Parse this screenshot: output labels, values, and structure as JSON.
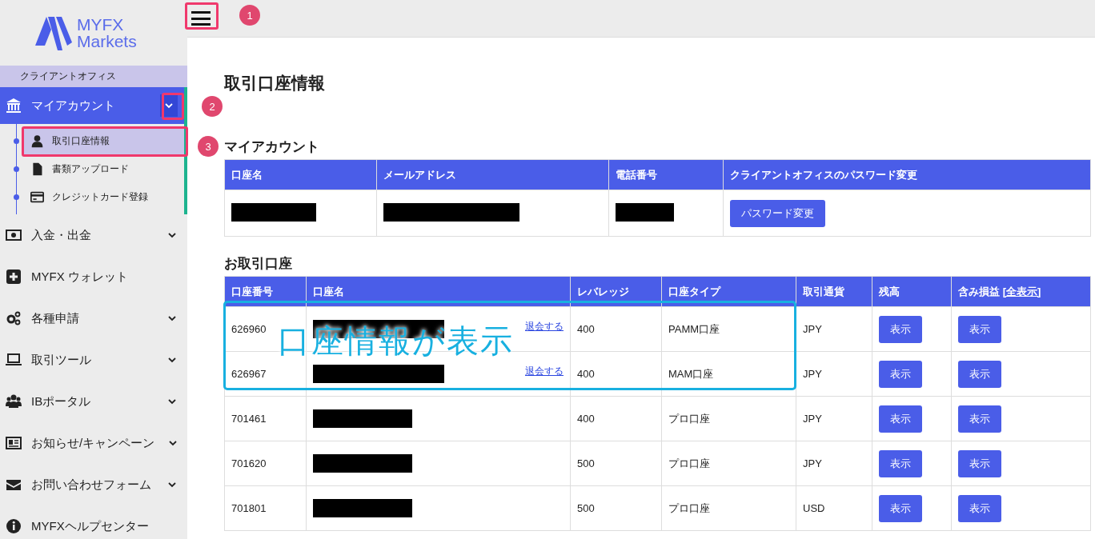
{
  "logo": {
    "line1": "MYFX",
    "line2": "Markets"
  },
  "sidebar": {
    "section": "クライアントオフィス",
    "items": [
      {
        "label": "マイアカウント",
        "kind": "group",
        "selected": true,
        "children": [
          {
            "label": "取引口座情報",
            "selected": true
          },
          {
            "label": "書類アップロード",
            "selected": false
          },
          {
            "label": "クレジットカード登録",
            "selected": false
          }
        ]
      },
      {
        "label": "入金・出金",
        "kind": "group",
        "selected": false
      },
      {
        "label": "MYFX ウォレット",
        "kind": "link",
        "selected": false
      },
      {
        "label": "各種申請",
        "kind": "group",
        "selected": false
      },
      {
        "label": "取引ツール",
        "kind": "group",
        "selected": false
      },
      {
        "label": "IBポータル",
        "kind": "group",
        "selected": false
      },
      {
        "label": "お知らせ/キャンペーン",
        "kind": "group",
        "selected": false
      },
      {
        "label": "お問い合わせフォーム",
        "kind": "group",
        "selected": false
      },
      {
        "label": "MYFXヘルプセンター",
        "kind": "link",
        "selected": false
      }
    ]
  },
  "page_title": "取引口座情報",
  "my_account": {
    "heading": "マイアカウント",
    "columns": [
      "口座名",
      "メールアドレス",
      "電話番号",
      "クライアントオフィスのパスワード変更"
    ],
    "row": {
      "name_redacted": true,
      "email_redacted": true,
      "phone_redacted": true,
      "button": "パスワード変更"
    }
  },
  "trading_accounts": {
    "heading": "お取引口座",
    "columns": [
      "口座番号",
      "口座名",
      "レバレッジ",
      "口座タイプ",
      "取引通貨",
      "残高",
      "含み損益 "
    ],
    "columns_link": "[全表示]",
    "rows": [
      {
        "number": "626960",
        "name_redacted": true,
        "withdraw_link": "退会する",
        "leverage": "400",
        "type": "PAMM口座",
        "currency": "JPY",
        "balance_button": "表示",
        "pl_button": "表示"
      },
      {
        "number": "626967",
        "name_redacted": true,
        "withdraw_link": "退会する",
        "leverage": "400",
        "type": "MAM口座",
        "currency": "JPY",
        "balance_button": "表示",
        "pl_button": "表示"
      },
      {
        "number": "701461",
        "name_redacted": true,
        "leverage": "400",
        "type": "プロ口座",
        "currency": "JPY",
        "balance_button": "表示",
        "pl_button": "表示"
      },
      {
        "number": "701620",
        "name_redacted": true,
        "leverage": "500",
        "type": "プロ口座",
        "currency": "JPY",
        "balance_button": "表示",
        "pl_button": "表示"
      },
      {
        "number": "701801",
        "name_redacted": true,
        "leverage": "500",
        "type": "プロ口座",
        "currency": "USD",
        "balance_button": "表示",
        "pl_button": "表示"
      }
    ]
  },
  "annotations": {
    "callouts": [
      "1",
      "2",
      "3"
    ],
    "caption": "口座情報が表示"
  }
}
